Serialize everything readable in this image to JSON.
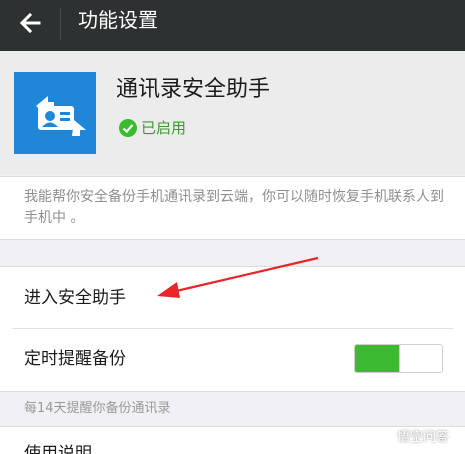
{
  "topbar": {
    "title": "功能设置",
    "back_icon": "arrow-left-icon"
  },
  "header": {
    "app_name": "通讯录安全助手",
    "status_text": "已启用",
    "status_icon": "check-circle-icon"
  },
  "description": "我能帮你安全备份手机通讯录到云端，你可以随时恢复手机联系人到手机中 。",
  "settings": [
    {
      "label": "进入安全助手"
    },
    {
      "label": "定时提醒备份",
      "toggle_on": true
    }
  ],
  "hint": "每14天提醒你备份通讯录",
  "next_item": "使用说明",
  "watermark": "悟空问答",
  "colors": {
    "topbar": "#2e3132",
    "accent_green": "#3dbb30",
    "app_icon_blue": "#1f86d8",
    "annotation_arrow": "#e8262a"
  }
}
